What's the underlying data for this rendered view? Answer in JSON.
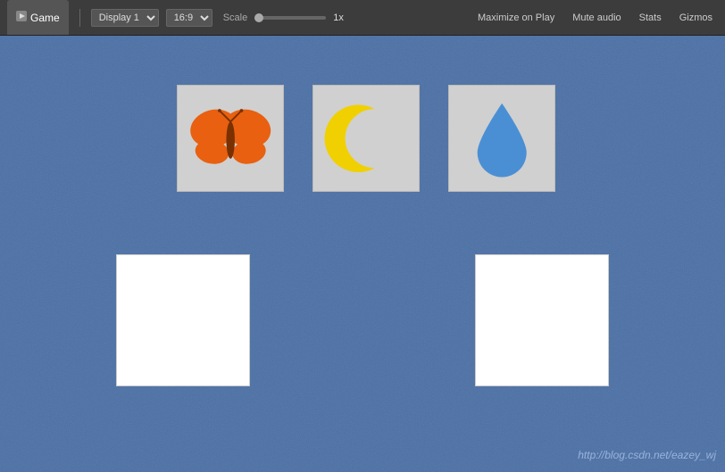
{
  "toolbar": {
    "game_tab_label": "Game",
    "display_label": "Display 1",
    "aspect_label": "16:9",
    "scale_label": "Scale",
    "scale_value": "1x",
    "maximize_label": "Maximize on Play",
    "mute_label": "Mute audio",
    "stats_label": "Stats",
    "gizmos_label": "Gizmos"
  },
  "game": {
    "card1_name": "butterfly-card",
    "card2_name": "moon-card",
    "card3_name": "water-card",
    "card4_name": "empty-card-1",
    "card5_name": "empty-card-2"
  },
  "watermark": {
    "text": "http://blog.csdn.net/eazey_wj"
  }
}
